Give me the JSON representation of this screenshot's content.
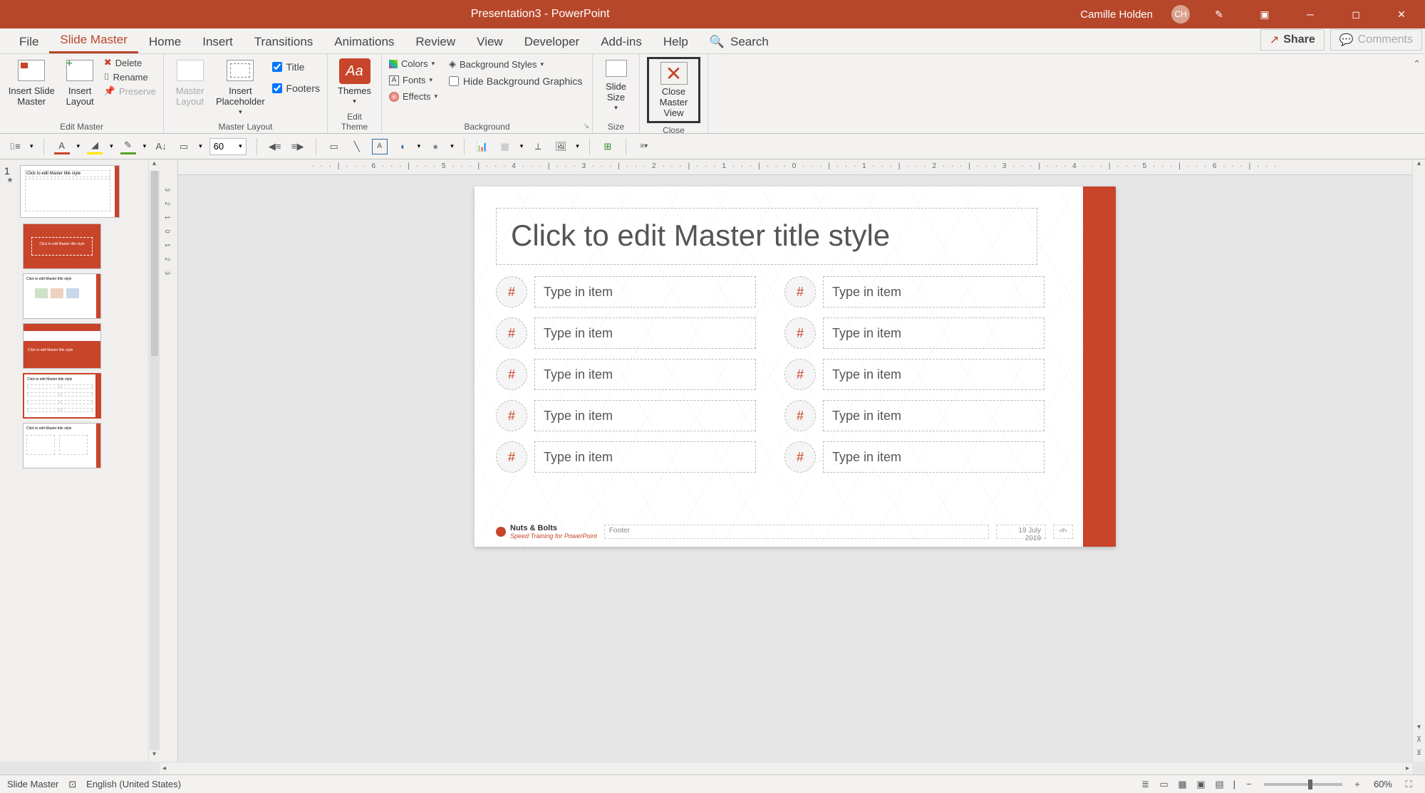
{
  "title": "Presentation3  -  PowerPoint",
  "user": {
    "name": "Camille Holden",
    "initials": "CH"
  },
  "tabs": {
    "file": "File",
    "slidemaster": "Slide Master",
    "home": "Home",
    "insert": "Insert",
    "transitions": "Transitions",
    "animations": "Animations",
    "review": "Review",
    "view": "View",
    "developer": "Developer",
    "addins": "Add-ins",
    "help": "Help",
    "search": "Search",
    "share": "Share",
    "comments": "Comments"
  },
  "ribbon": {
    "insert_slide_master": "Insert Slide\nMaster",
    "insert_layout": "Insert\nLayout",
    "delete": "Delete",
    "rename": "Rename",
    "preserve": "Preserve",
    "edit_master": "Edit Master",
    "master_layout": "Master\nLayout",
    "insert_placeholder": "Insert\nPlaceholder",
    "title_chk": "Title",
    "footers_chk": "Footers",
    "master_layout_grp": "Master Layout",
    "themes": "Themes",
    "edit_theme": "Edit Theme",
    "colors": "Colors",
    "fonts": "Fonts",
    "effects": "Effects",
    "bg_styles": "Background Styles",
    "hide_bg": "Hide Background Graphics",
    "background": "Background",
    "slide_size": "Slide\nSize",
    "size_grp": "Size",
    "close_master": "Close\nMaster View",
    "close_grp": "Close"
  },
  "toolbar2": {
    "fontsize": "60"
  },
  "thumbs": {
    "num": "1"
  },
  "slide": {
    "title_ph": "Click to edit Master title style",
    "item_ph": "Type in item",
    "hash": "#",
    "footer_ph": "Footer",
    "date": "19 July 2019",
    "logo1": "Nuts & Bolts",
    "logo2": "Speed Training for PowerPoint",
    "num_ph": "‹#›"
  },
  "status": {
    "mode": "Slide Master",
    "lang": "English (United States)",
    "zoom": "60%"
  },
  "ruler": "· · · | · · · 6 · · · | · · · 5 · · · | · · · 4 · · · | · · · 3 · · · | · · · 2 · · · | · · · 1 · · · | · · · 0 · · · | · · · 1 · · · | · · · 2 · · · | · · · 3 · · · | · · · 4 · · · | · · · 5 · · · | · · · 6 · · · | · · ·"
}
